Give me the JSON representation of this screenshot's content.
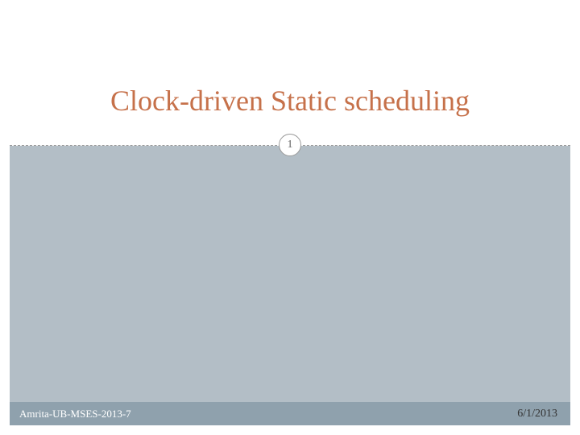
{
  "slide": {
    "title": "Clock-driven Static scheduling",
    "page_number": "1",
    "footer_text": "Amrita-UB-MSES-2013-7",
    "date": "6/1/2013"
  }
}
